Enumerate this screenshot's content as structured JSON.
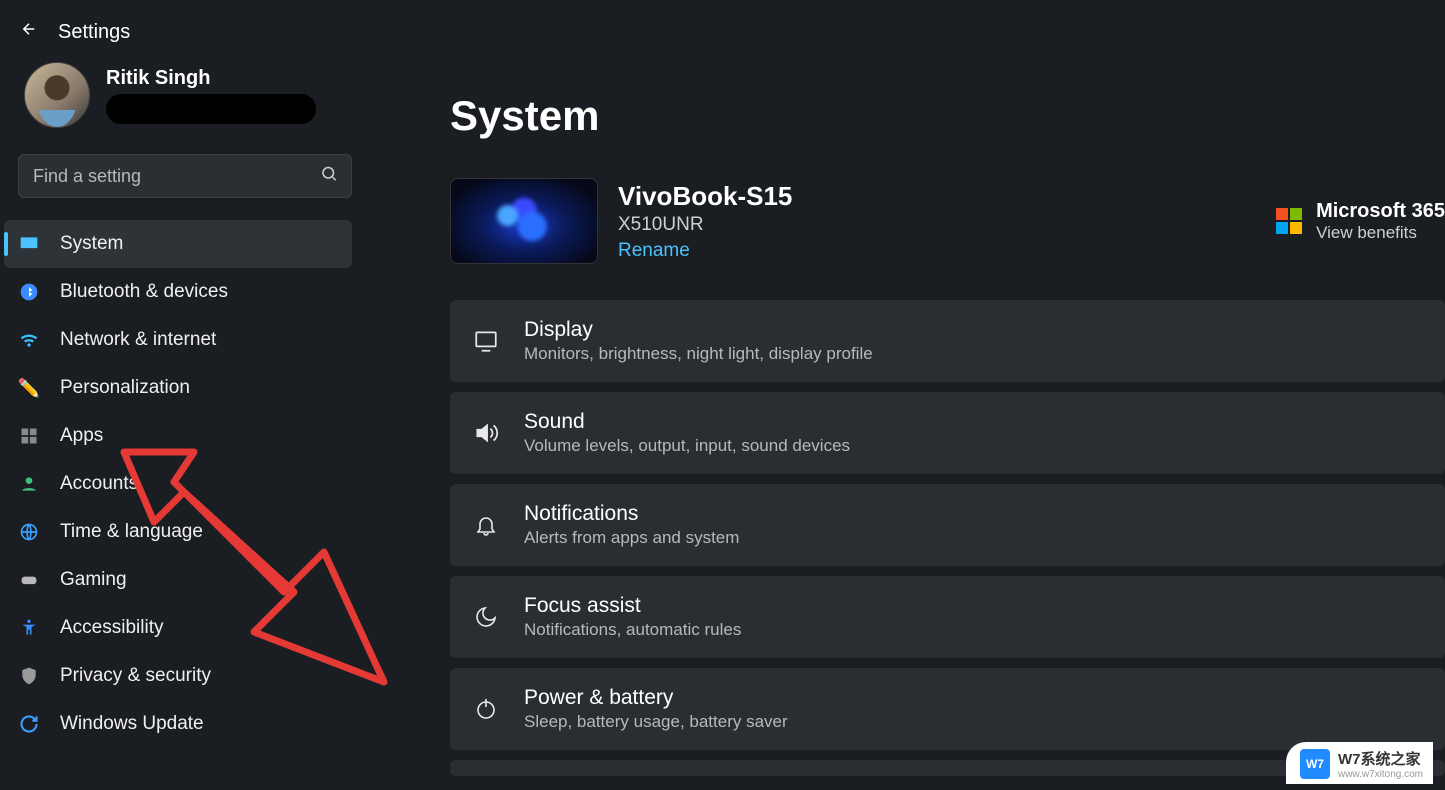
{
  "header": {
    "title": "Settings"
  },
  "profile": {
    "name": "Ritik Singh"
  },
  "search": {
    "placeholder": "Find a setting"
  },
  "sidebar": {
    "items": [
      {
        "label": "System"
      },
      {
        "label": "Bluetooth & devices"
      },
      {
        "label": "Network & internet"
      },
      {
        "label": "Personalization"
      },
      {
        "label": "Apps"
      },
      {
        "label": "Accounts"
      },
      {
        "label": "Time & language"
      },
      {
        "label": "Gaming"
      },
      {
        "label": "Accessibility"
      },
      {
        "label": "Privacy & security"
      },
      {
        "label": "Windows Update"
      }
    ]
  },
  "main": {
    "title": "System",
    "device": {
      "name": "VivoBook-S15",
      "model": "X510UNR",
      "rename": "Rename"
    },
    "ms365": {
      "title": "Microsoft 365",
      "link": "View benefits"
    },
    "tiles": [
      {
        "title": "Display",
        "sub": "Monitors, brightness, night light, display profile"
      },
      {
        "title": "Sound",
        "sub": "Volume levels, output, input, sound devices"
      },
      {
        "title": "Notifications",
        "sub": "Alerts from apps and system"
      },
      {
        "title": "Focus assist",
        "sub": "Notifications, automatic rules"
      },
      {
        "title": "Power & battery",
        "sub": "Sleep, battery usage, battery saver"
      }
    ]
  },
  "watermark": {
    "badge": "W7",
    "line1": "W7系统之家",
    "line2": "www.w7xitong.com"
  }
}
